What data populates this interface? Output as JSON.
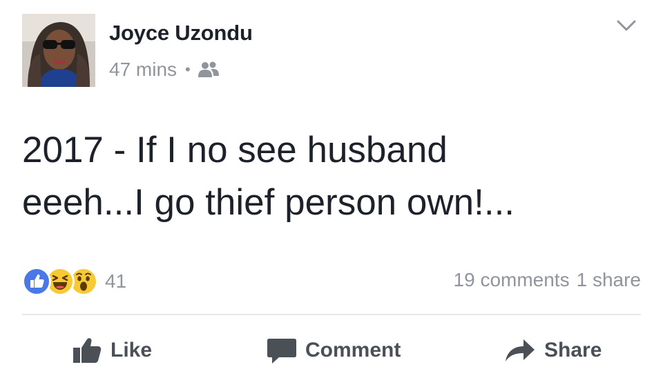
{
  "author": {
    "name": "Joyce Uzondu",
    "timestamp": "47 mins",
    "separator": "•",
    "audience_icon": "friends-icon"
  },
  "post": {
    "lines": [
      "2017 - If I no see husband",
      "eeeh...I go thief person own!..."
    ]
  },
  "reactions": {
    "types": [
      "like",
      "haha",
      "wow"
    ],
    "count": "41"
  },
  "stats": {
    "comments": "19 comments",
    "shares": "1 share"
  },
  "actions": {
    "like_label": "Like",
    "comment_label": "Comment",
    "share_label": "Share"
  },
  "colors": {
    "text_primary": "#1d2129",
    "text_secondary": "#90949c",
    "action_text": "#4b4f56",
    "like_blue": "#4a78e6",
    "emoji_yellow": "#f7c935",
    "divider": "#e5e6e9"
  }
}
